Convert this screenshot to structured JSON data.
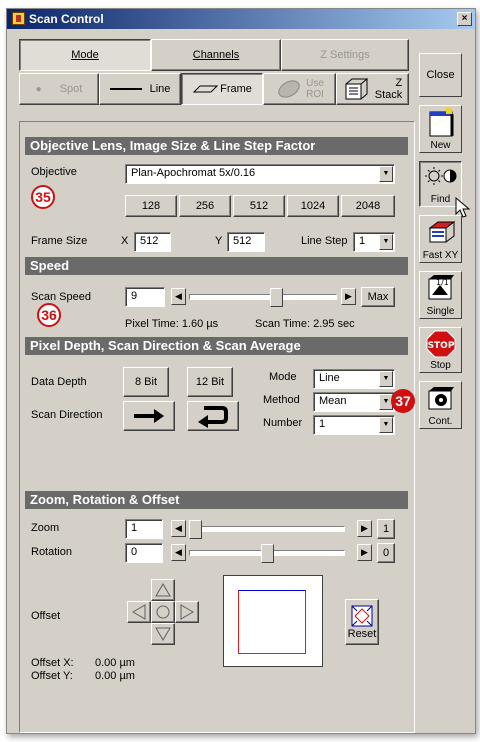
{
  "window": {
    "title": "Scan Control",
    "close_x": "×"
  },
  "tabs": {
    "mode": "Mode",
    "channels": "Channels",
    "zsettings": "Z Settings"
  },
  "modebar": {
    "spot": "Spot",
    "line": "Line",
    "frame": "Frame",
    "use_roi_1": "Use",
    "use_roi_2": "ROI",
    "zstack_1": "Z",
    "zstack_2": "Stack"
  },
  "sections": {
    "objective": "Objective Lens, Image Size & Line Step Factor",
    "speed": "Speed",
    "pixel": "Pixel Depth, Scan Direction & Scan Average",
    "zoom": "Zoom, Rotation & Offset"
  },
  "objective": {
    "label": "Objective",
    "value": "Plan-Apochromat 5x/0.16",
    "sizes": [
      "128",
      "256",
      "512",
      "1024",
      "2048"
    ],
    "frame_size_label": "Frame Size",
    "x_label": "X",
    "x_value": "512",
    "y_label": "Y",
    "y_value": "512",
    "line_step_label": "Line Step",
    "line_step_value": "1"
  },
  "speed": {
    "label": "Scan Speed",
    "value": "9",
    "max_label": "Max",
    "level_fraction": 0.6,
    "pixel_time": "Pixel Time: 1.60 µs",
    "scan_time": "Scan Time: 2.95 sec"
  },
  "pixel": {
    "data_depth_label": "Data Depth",
    "bit8": "8 Bit",
    "bit12": "12 Bit",
    "scan_direction_label": "Scan Direction",
    "mode_label": "Mode",
    "mode_value": "Line",
    "method_label": "Method",
    "method_value": "Mean",
    "number_label": "Number",
    "number_value": "1"
  },
  "zoom": {
    "zoom_label": "Zoom",
    "zoom_value": "1",
    "zoom_end": "1",
    "zoom_fraction": 0.0,
    "rotation_label": "Rotation",
    "rotation_value": "0",
    "rotation_end": "0",
    "rotation_fraction": 0.5,
    "offset_label": "Offset",
    "reset_label": "Reset",
    "offset_x_label": "Offset X:",
    "offset_x_value": "0.00 µm",
    "offset_y_label": "Offset Y:",
    "offset_y_value": "0.00 µm"
  },
  "side": {
    "close": "Close",
    "new": "New",
    "find": "Find",
    "fastxy": "Fast XY",
    "single": "Single",
    "stop": "Stop",
    "cont": "Cont.",
    "stop_sign": "STOP"
  },
  "callouts": {
    "c35": "35",
    "c36": "36",
    "c37": "37"
  },
  "colors": {
    "section_bg": "#6b6a6a",
    "window_bg": "#d4d0c8",
    "callout": "#d01010",
    "frame_blue": "#0000d0",
    "frame_red": "#e02020"
  }
}
